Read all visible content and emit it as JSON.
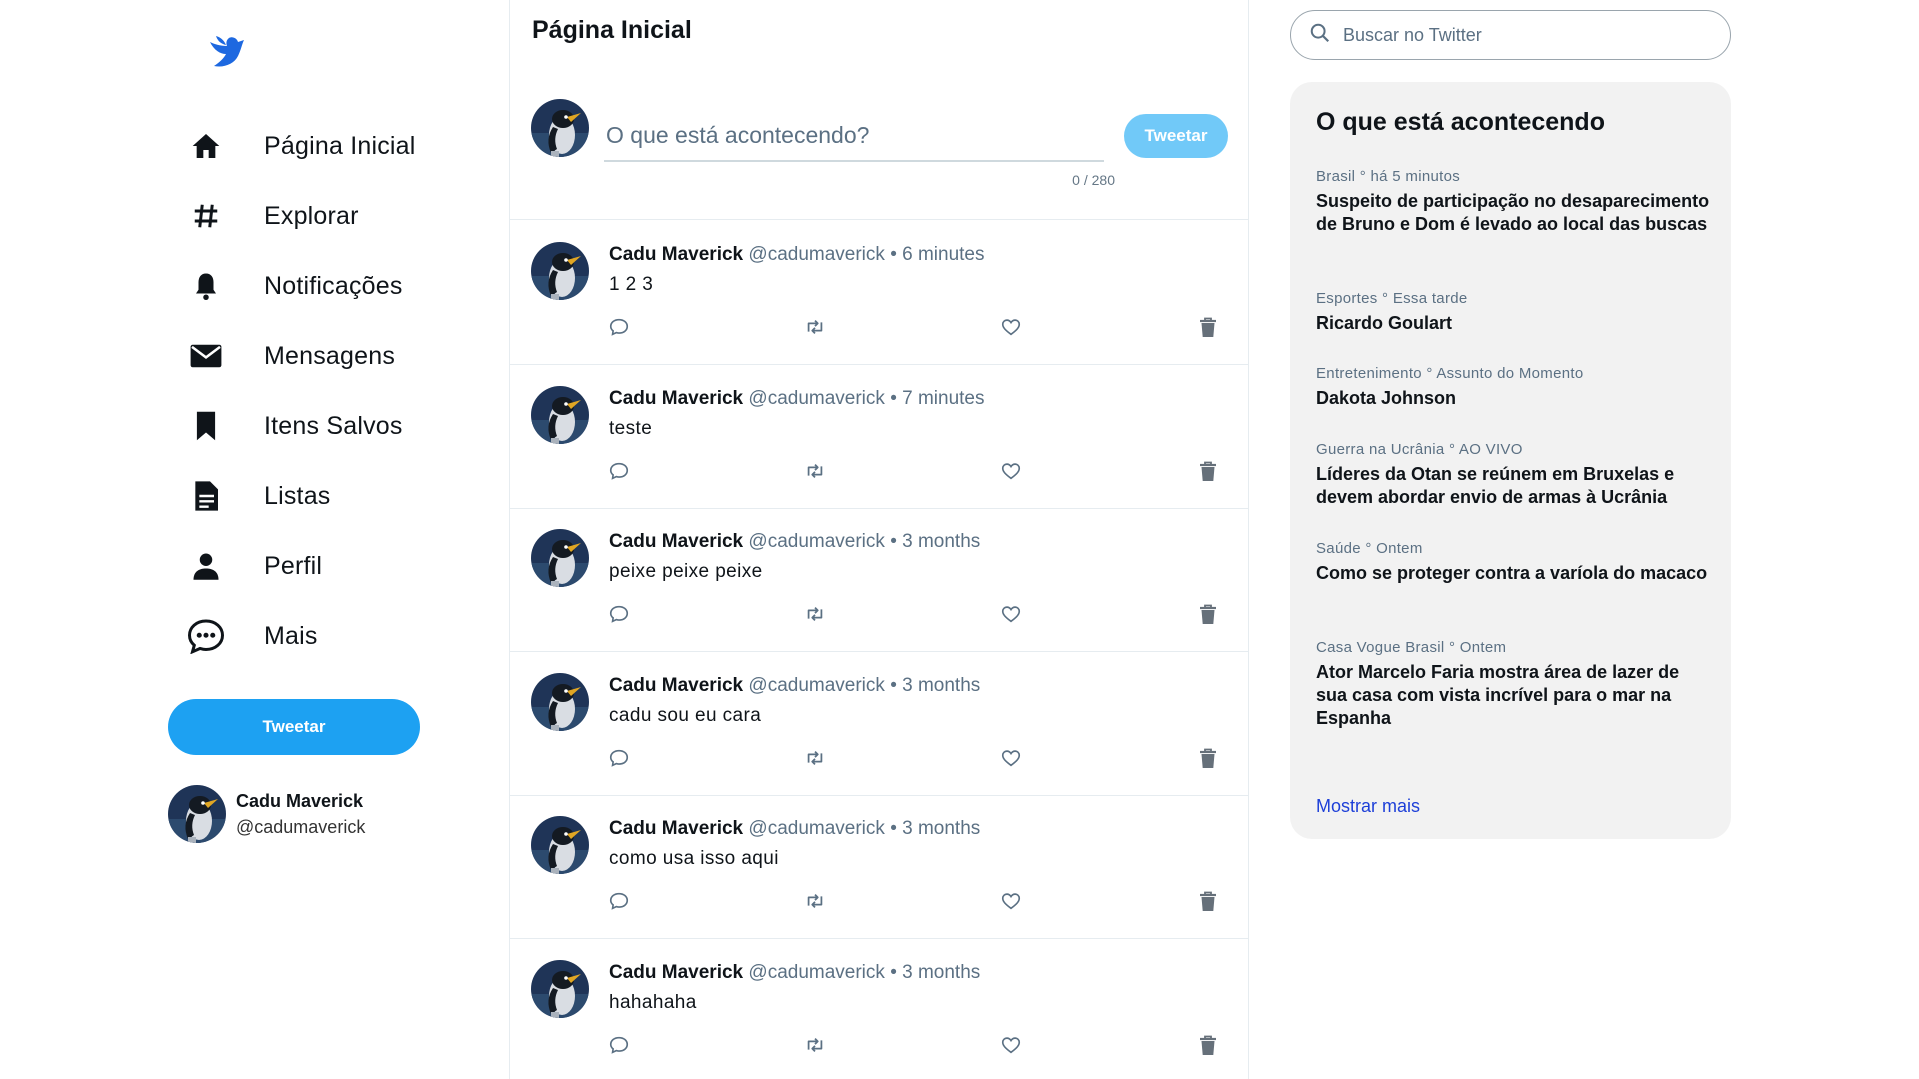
{
  "colors": {
    "brand_blue": "#1da1f2",
    "compose_button": "#71c9f8",
    "link_blue": "#1d3fd8",
    "trends_bg": "#f2f2f2"
  },
  "sidebar": {
    "logo": "bird-icon",
    "items": [
      {
        "label": "Página Inicial",
        "icon": "home-icon"
      },
      {
        "label": "Explorar",
        "icon": "hashtag-icon"
      },
      {
        "label": "Notificações",
        "icon": "bell-icon"
      },
      {
        "label": "Mensagens",
        "icon": "envelope-icon"
      },
      {
        "label": "Itens Salvos",
        "icon": "bookmark-icon"
      },
      {
        "label": "Listas",
        "icon": "list-icon"
      },
      {
        "label": "Perfil",
        "icon": "person-icon"
      },
      {
        "label": "Mais",
        "icon": "more-bubble-icon"
      }
    ],
    "tweet_button": "Tweetar",
    "profile": {
      "name": "Cadu Maverick",
      "handle": "@cadumaverick"
    }
  },
  "main": {
    "title": "Página Inicial",
    "composer": {
      "placeholder": "O que está acontecendo?",
      "counter": "0 / 280",
      "button": "Tweetar"
    },
    "tweets": [
      {
        "author": "Cadu Maverick",
        "handle": "@cadumaverick",
        "separator": "•",
        "time": "6 minutes",
        "text": "1 2 3"
      },
      {
        "author": "Cadu Maverick",
        "handle": "@cadumaverick",
        "separator": "•",
        "time": "7 minutes",
        "text": "teste"
      },
      {
        "author": "Cadu Maverick",
        "handle": "@cadumaverick",
        "separator": "•",
        "time": "3 months",
        "text": "peixe peixe peixe"
      },
      {
        "author": "Cadu Maverick",
        "handle": "@cadumaverick",
        "separator": "•",
        "time": "3 months",
        "text": "cadu sou eu cara"
      },
      {
        "author": "Cadu Maverick",
        "handle": "@cadumaverick",
        "separator": "•",
        "time": "3 months",
        "text": "como usa isso aqui"
      },
      {
        "author": "Cadu Maverick",
        "handle": "@cadumaverick",
        "separator": "•",
        "time": "3 months",
        "text": "hahahaha"
      }
    ]
  },
  "right": {
    "search_placeholder": "Buscar no Twitter",
    "trends_title": "O que está acontecendo",
    "trends": [
      {
        "meta": "Brasil ° há 5 minutos",
        "headline": "Suspeito de participação no desaparecimento de Bruno e Dom é levado ao local das buscas"
      },
      {
        "meta": "Esportes ° Essa tarde",
        "headline": "Ricardo Goulart"
      },
      {
        "meta": "Entretenimento ° Assunto do Momento",
        "headline": "Dakota Johnson"
      },
      {
        "meta": "Guerra na Ucrânia ° AO VIVO",
        "headline": "Líderes da Otan se reúnem em Bruxelas e devem abordar envio de armas à Ucrânia"
      },
      {
        "meta": "Saúde ° Ontem",
        "headline": "Como se proteger contra a varíola do macaco"
      },
      {
        "meta": "Casa Vogue Brasil ° Ontem",
        "headline": "Ator Marcelo Faria mostra área de lazer de sua casa com vista incrível para o mar na Espanha"
      }
    ],
    "show_more": "Mostrar mais"
  }
}
